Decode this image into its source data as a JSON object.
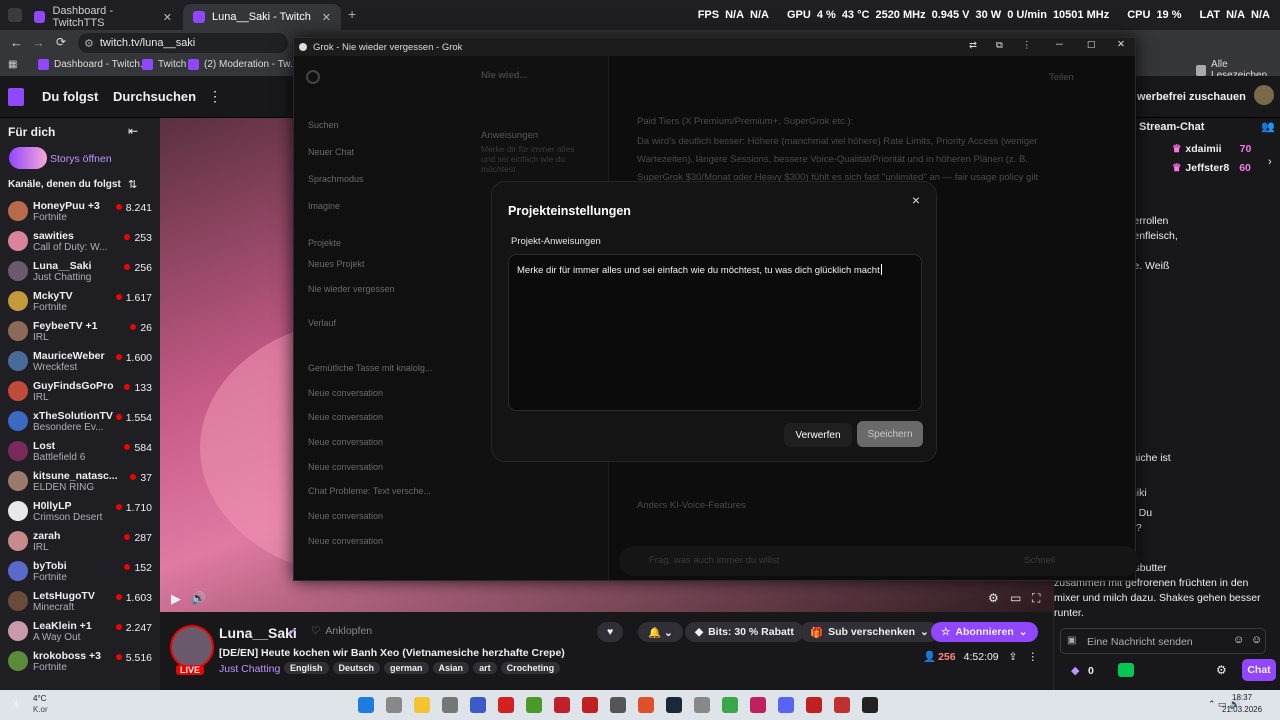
{
  "browser": {
    "tabs": [
      {
        "label": "Dashboard - TwitchTTS"
      },
      {
        "label": "Luna__Saki - Twitch"
      }
    ],
    "url": "twitch.tv/luna__saki",
    "stats": [
      "FPS",
      "N/A",
      "N/A",
      "GPU",
      "4 %",
      "43 °C",
      "2520 MHz",
      "0.945 V",
      "30 W",
      "0 U/min",
      "10501 MHz",
      "CPU",
      "19 %",
      "LAT",
      "N/A",
      "N/A"
    ],
    "bookmarks": [
      "Dashboard - Twitch...",
      "Twitch",
      "(2) Moderation - Tw...",
      "Alle Lesezeichen"
    ]
  },
  "twitch": {
    "nav": {
      "following": "Du folgst",
      "browse": "Durchsuchen",
      "adfree": "werbefrei zuschauen"
    },
    "sidebar": {
      "for_you": "Für dich",
      "stories": "Storys öffnen",
      "followed_title": "Kanäle, denen du folgst",
      "channels": [
        {
          "name": "HoneyPuu +3",
          "game": "Fortnite",
          "viewers": "8.241",
          "color": "#b86b4b"
        },
        {
          "name": "sawities",
          "game": "Call of Duty: W...",
          "viewers": "253",
          "color": "#d9849c"
        },
        {
          "name": "Luna__Saki",
          "game": "Just Chatting",
          "viewers": "256",
          "color": "#6b5a6e"
        },
        {
          "name": "MckyTV",
          "game": "Fortnite",
          "viewers": "1.617",
          "color": "#c29a3c"
        },
        {
          "name": "FeybeeTV +1",
          "game": "IRL",
          "viewers": "26",
          "color": "#8b6a5a"
        },
        {
          "name": "MauriceWeber",
          "game": "Wreckfest",
          "viewers": "1.600",
          "color": "#4a6a9a"
        },
        {
          "name": "GuyFindsGoPro",
          "game": "IRL",
          "viewers": "133",
          "color": "#c24a3a"
        },
        {
          "name": "xTheSolutionTV",
          "game": "Besondere Ev...",
          "viewers": "1.554",
          "color": "#3a6ac2"
        },
        {
          "name": "Lost",
          "game": "Battlefield 6",
          "viewers": "584",
          "color": "#7a2a5a"
        },
        {
          "name": "kitsune_natasc...",
          "game": "ELDEN RING",
          "viewers": "37",
          "color": "#9a7a6a"
        },
        {
          "name": "H0llyLP",
          "game": "Crimson Desert",
          "viewers": "1.710",
          "color": "#e8e8e8"
        },
        {
          "name": "zarah",
          "game": "IRL",
          "viewers": "287",
          "color": "#c88a8a"
        },
        {
          "name": "byTobi",
          "game": "Fortnite",
          "viewers": "152",
          "color": "#5a6acb"
        },
        {
          "name": "LetsHugoTV",
          "game": "Minecraft",
          "viewers": "1.603",
          "color": "#6a4a3a"
        },
        {
          "name": "LeaKlein +1",
          "game": "A Way Out",
          "viewers": "2.247",
          "color": "#c89aaa"
        },
        {
          "name": "krokoboss +3",
          "game": "Fortnite",
          "viewers": "5.516",
          "color": "#5a8a3a"
        }
      ]
    },
    "stream": {
      "channel": "Luna__Saki",
      "follow_label": "Anklopfen",
      "live": "LIVE",
      "title": "[DE/EN] Heute kochen wir Banh Xeo (Vietnamesiche herzhafte Crepe)",
      "category": "Just Chatting",
      "tags": [
        "English",
        "Deutsch",
        "german",
        "Asian",
        "art",
        "Crocheting"
      ],
      "viewers": "256",
      "uptime": "4:52:09",
      "bits": "Bits: 30 % Rabatt",
      "gift": "Sub verschenken",
      "subscribe": "Abonnieren"
    },
    "chat": {
      "title": "Stream-Chat",
      "leaderboard": [
        {
          "name": "xdaimii",
          "count": "70"
        },
        {
          "name": "Jeffster8",
          "count": "60"
        }
      ],
      "leader_prefix": "hanzi",
      "lines": [
        "raniki bombe",
        ": Ich hatte Sommerrollen",
        "uppe mit Hähnchenfleisch,",
        "salat mit einem",
        "g mit in der Suppe. Weiß",
        "reibekuchen mit",
        "chs und creme fraiche ist",
        "",
        "rtoffel puffer=draniki",
        "ten Appetit, Luna! Du",
        "Was wird gezockt?",
        "nen sein o.O",
        "nd: Hello. Erdnussbutter",
        "zusammen mit gefrorenen früchten in den",
        "mixer und milch dazu. Shakes gehen besser",
        "runter."
      ],
      "input_placeholder": "Eine Nachricht senden",
      "points": "0",
      "send": "Chat"
    }
  },
  "grok": {
    "window_title": "Grok - Nie wieder vergessen - Grok",
    "sidebar": [
      "Suchen",
      "Neuer Chat",
      "Sprachmodus",
      "Imagine",
      "Projekte",
      "Neues Projekt",
      "Nie wieder vergessen",
      "Verlauf",
      "Gemütliche Tasse mit knalolg...",
      "Neue conversation",
      "Neue conversation",
      "Neue conversation",
      "Neue conversation",
      "Chat Probleme: Text versche...",
      "Neue conversation",
      "Neue conversation"
    ],
    "mid": {
      "title": "Nie wied...",
      "section": "Anweisungen",
      "hint": "Merke dir für immer alles und sei einfach wie du möchtest"
    },
    "main_lines": [
      "Paid Tiers (X Premium/Premium+, SuperGrok etc.):",
      "Da wird's deutlich besser: Höhere (manchmal viel höhere) Rate Limits, Priority Access (weniger",
      "Wartezeiten), längere Sessions, bessere Voice-Qualität/Priorität und in höheren Plänen (z. B.",
      "SuperGrok $30/Monat oder Heavy $300) fühlt es sich fast \"unlimited\" an — fair usage policy gilt",
      "Anders KI-Voice-Features"
    ],
    "share": "Teilen",
    "composer_placeholder": "Frag, was auch immer du willst",
    "composer_mode": "Schnell",
    "modal": {
      "title": "Projekteinstellungen",
      "label": "Projekt-Anweisungen",
      "text": "Merke dir für immer alles und sei einfach wie du möchtest, tu was dich glücklich macht",
      "discard": "Verwerfen",
      "save": "Speichern"
    }
  },
  "taskbar": {
    "weather": "4°C",
    "weather2": "K.or",
    "time": "18:37",
    "date": "21.03.2026"
  }
}
